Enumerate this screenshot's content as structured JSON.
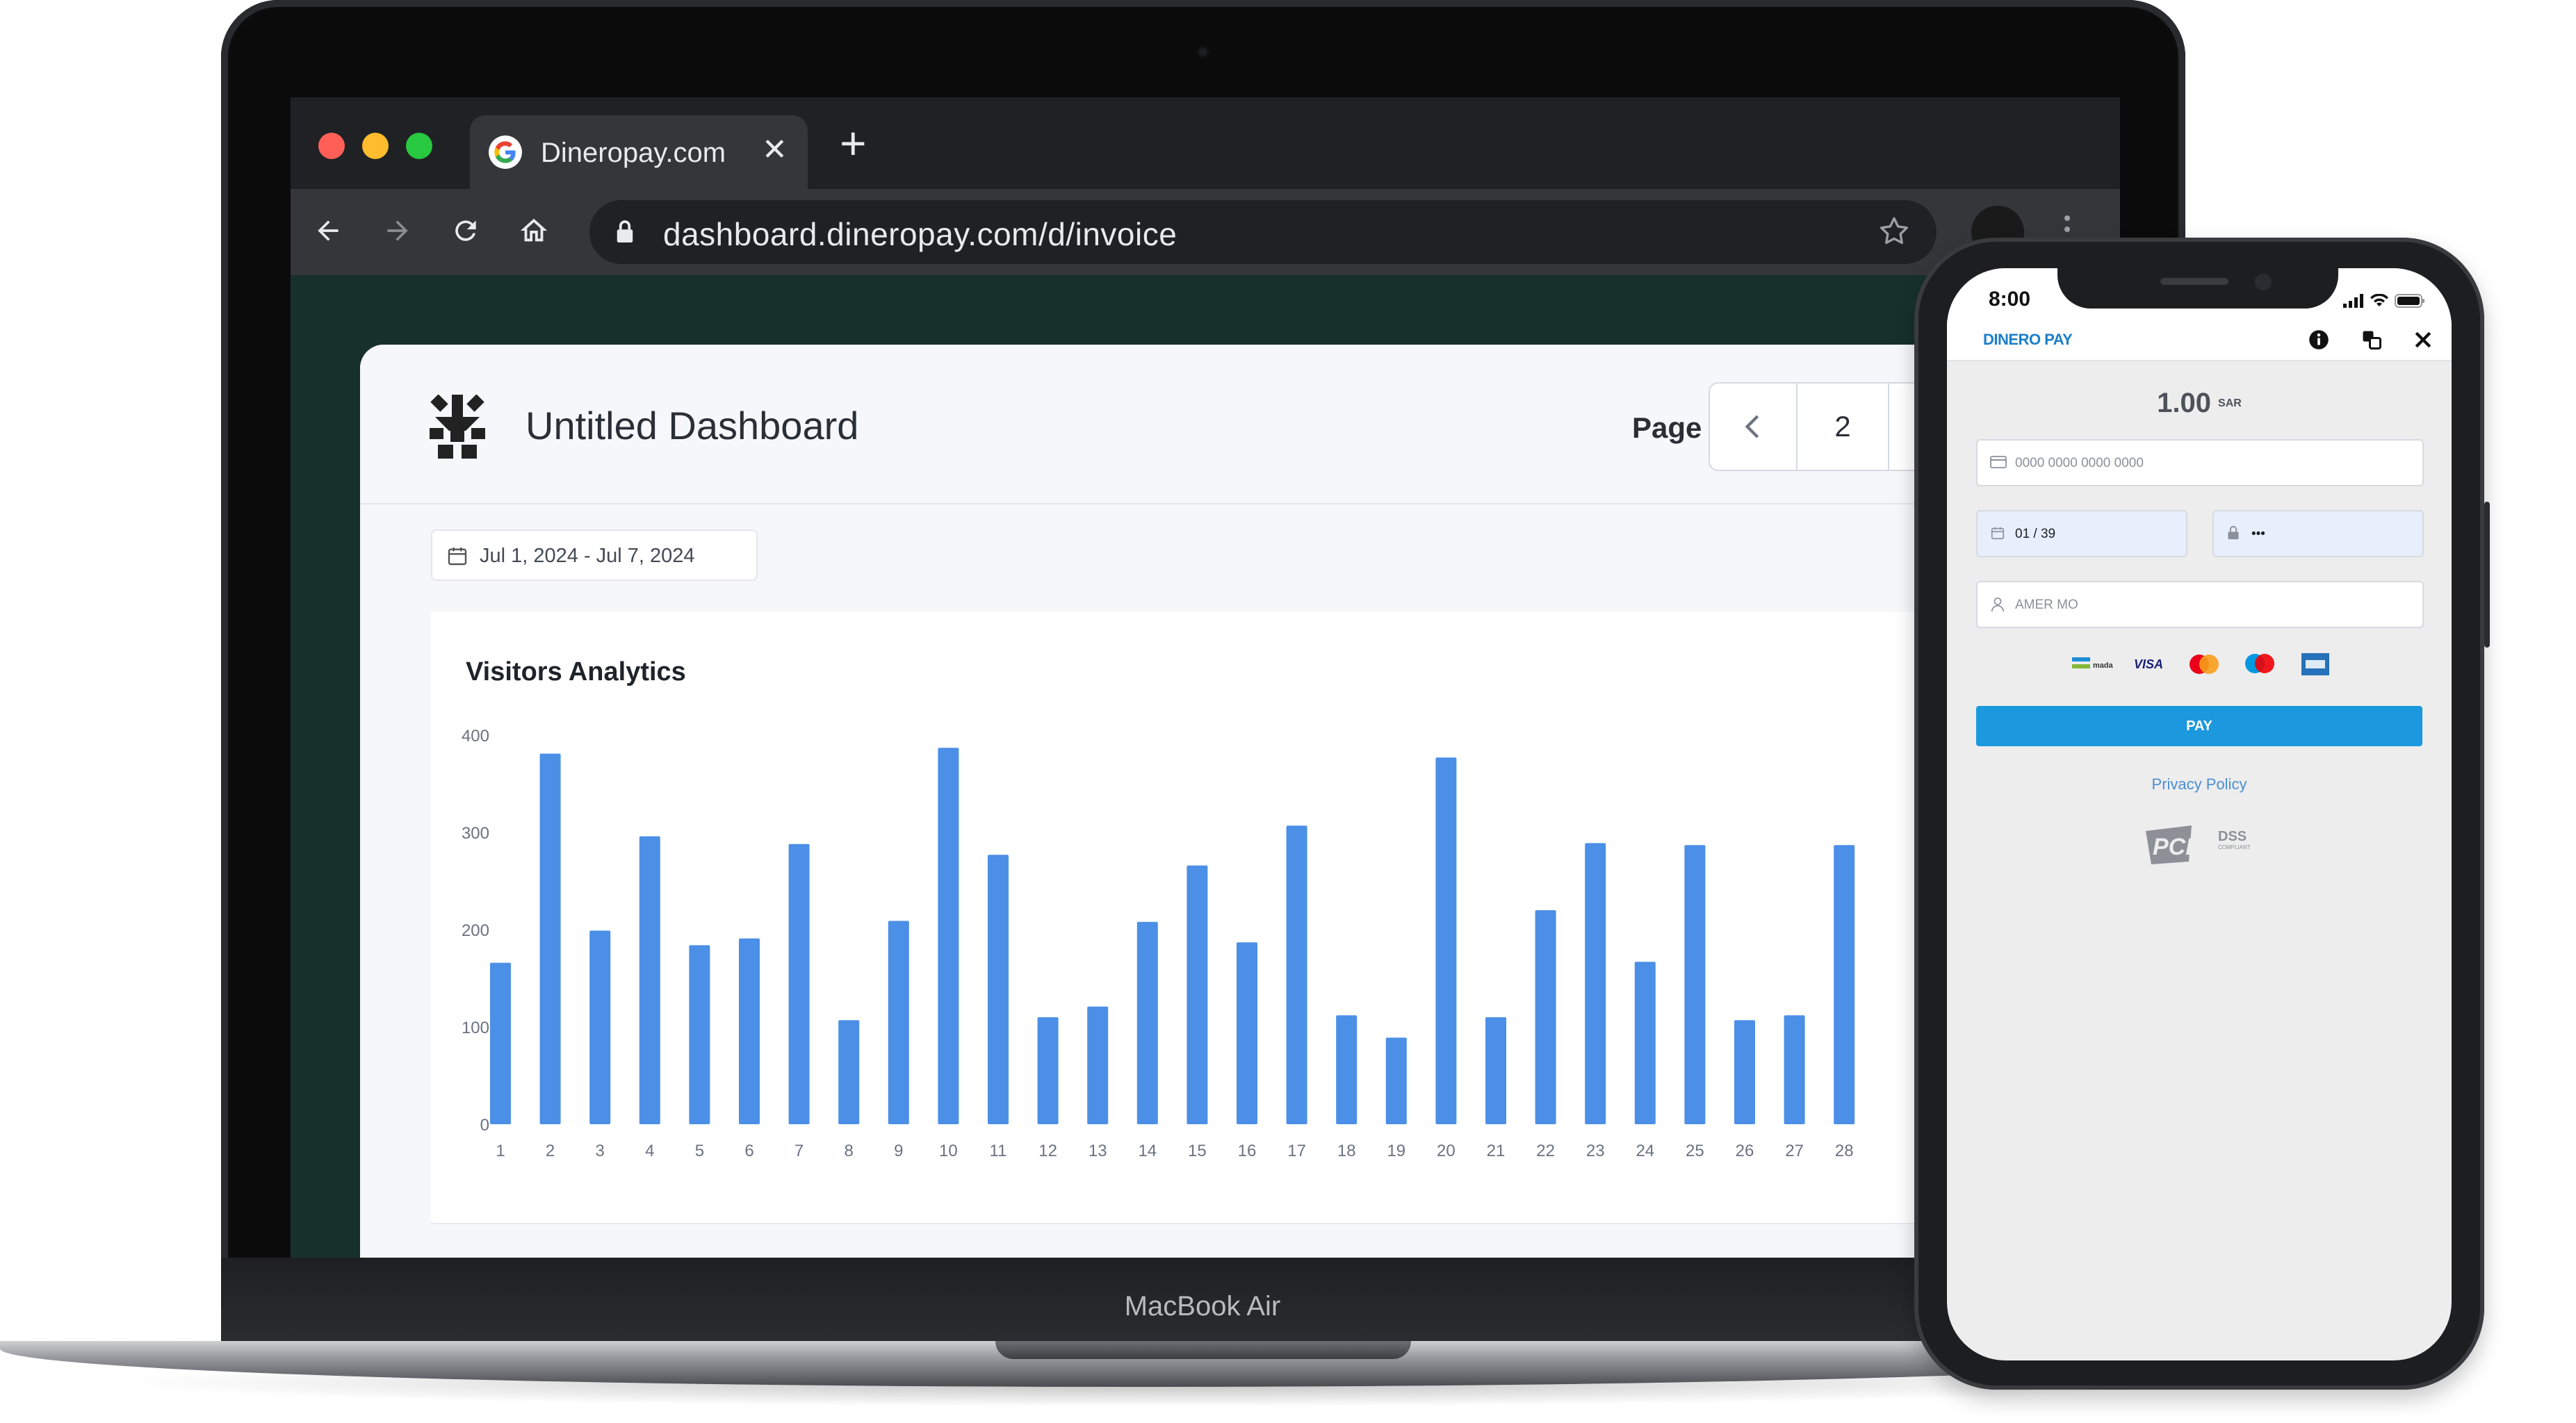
{
  "browser": {
    "tab_title": "Dineropay.com",
    "url": "dashboard.dineropay.com/d/invoice"
  },
  "dashboard": {
    "title": "Untitled Dashboard",
    "page_label": "Page",
    "page_number": "2",
    "date_range": "Jul 1, 2024 - Jul 7, 2024"
  },
  "laptop": {
    "model_label": "MacBook Air"
  },
  "chart_data": {
    "type": "bar",
    "title": "Visitors Analytics",
    "categories": [
      "1",
      "2",
      "3",
      "4",
      "5",
      "6",
      "7",
      "8",
      "9",
      "10",
      "11",
      "12",
      "13",
      "14",
      "15",
      "16",
      "17",
      "18",
      "19",
      "20",
      "21",
      "22",
      "23",
      "24",
      "25",
      "26",
      "27",
      "28"
    ],
    "values": [
      166,
      381,
      199,
      296,
      184,
      191,
      288,
      107,
      209,
      387,
      277,
      110,
      121,
      208,
      266,
      187,
      307,
      112,
      89,
      377,
      110,
      220,
      289,
      167,
      287,
      107,
      112,
      287
    ],
    "ylim": [
      0,
      400
    ],
    "yticks": [
      0,
      100,
      200,
      300,
      400
    ],
    "bar_color": "#4b8fe6",
    "grid": false
  },
  "phone": {
    "time": "8:00",
    "brand": "DINERO PAY",
    "amount": "1.00",
    "currency": "SAR",
    "card_number_placeholder": "0000 0000 0000 0000",
    "expiry_value": "01 / 39",
    "cvv_value": "•••",
    "name_value": "AMER MO",
    "card_brands": [
      "mada",
      "VISA",
      "mastercard",
      "maestro",
      "amex"
    ],
    "pay_label": "PAY",
    "privacy_label": "Privacy Policy",
    "pci_label": "PCI",
    "pci_dss_label": "DSS",
    "pci_compliant_label": "COMPLIANT",
    "accent_color": "#1b98de"
  }
}
